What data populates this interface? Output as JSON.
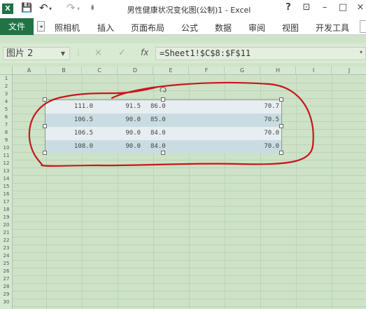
{
  "window": {
    "title": "男性健康状况变化图(公制)1 - Excel",
    "app_icon": "X",
    "controls": [
      "?",
      "⊡",
      "–",
      "□",
      "×"
    ]
  },
  "quick_access": {
    "icons": [
      "save-icon",
      "undo-icon",
      "redo-icon",
      "customize-icon"
    ]
  },
  "ribbon": {
    "file_tab": "文件",
    "tabs": [
      "照相机",
      "插入",
      "页面布局",
      "公式",
      "数据",
      "审阅",
      "视图",
      "开发工具"
    ]
  },
  "formula_bar": {
    "name_box": "图片 2",
    "cancel": "×",
    "enter": "✓",
    "fx": "fx",
    "formula": "=Sheet1!$C$8:$F$11"
  },
  "columns": [
    "A",
    "B",
    "C",
    "D",
    "E",
    "F",
    "G",
    "H",
    "I",
    "J"
  ],
  "rows": [
    "1",
    "2",
    "3",
    "4",
    "5",
    "6",
    "7",
    "8",
    "9",
    "10",
    "11",
    "12",
    "13",
    "14",
    "15",
    "16",
    "17",
    "18",
    "19",
    "20",
    "21",
    "22",
    "23",
    "24",
    "25",
    "26",
    "27",
    "28",
    "29",
    "30"
  ],
  "picture": {
    "rows": [
      {
        "c1": "111.0",
        "c2": "91.5",
        "c3": "86.0",
        "c4": "70.7"
      },
      {
        "c1": "106.5",
        "c2": "90.0",
        "c3": "85.0",
        "c4": "70.5"
      },
      {
        "c1": "106.5",
        "c2": "90.0",
        "c3": "84.0",
        "c4": "70.0"
      },
      {
        "c1": "108.0",
        "c2": "90.0",
        "c3": "84.0",
        "c4": "70.0"
      }
    ],
    "row_colors": [
      "#e6eef1",
      "#c9dce1",
      "#e6eef1",
      "#c9dce1"
    ]
  },
  "annotation": {
    "color": "#c8161d"
  }
}
